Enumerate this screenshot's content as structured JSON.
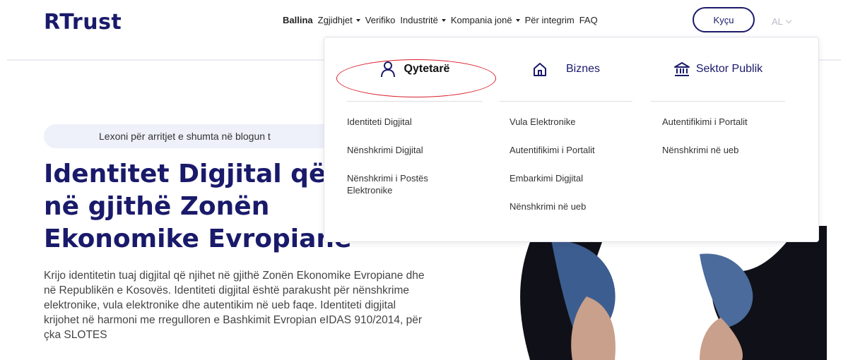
{
  "header": {
    "logo": "RTrust",
    "nav": [
      {
        "label": "Ballina",
        "active": true,
        "dropdown": false
      },
      {
        "label": "Zgjidhjet",
        "active": false,
        "dropdown": true
      },
      {
        "label": "Verifiko",
        "active": false,
        "dropdown": false
      },
      {
        "label": "Industritë",
        "active": false,
        "dropdown": true
      },
      {
        "label": "Kompania jonë",
        "active": false,
        "dropdown": true
      },
      {
        "label": "Për integrim",
        "active": false,
        "dropdown": false
      },
      {
        "label": "FAQ",
        "active": false,
        "dropdown": false
      }
    ],
    "login_label": "Kyçu",
    "language": "AL"
  },
  "hero": {
    "blog_banner": "Lexoni për arritjet e shumta në blogun t",
    "title_line1": "Identitet Digjital që",
    "title_line2": "në gjithë Zonën",
    "title_line3": "Ekonomike Evropiane",
    "description": "Krijo identitetin tuaj digjital që njihet në gjithë Zonën Ekonomike Evropiane dhe në Republikën e Kosovës. Identiteti digjital është parakusht për nënshkrime elektronike, vula elektronike dhe autentikim në ueb faqe. Identiteti digjital krijohet në harmoni me rregulloren e Bashkimit Evropian eIDAS 910/2014, për çka SLOTES"
  },
  "dropdown": {
    "columns": [
      {
        "title": "Qytetarë",
        "icon": "user-icon",
        "items": [
          "Identiteti Digjital",
          "Nënshkrimi Digjital",
          "Nënshkrimi i Postës Elektronike"
        ]
      },
      {
        "title": "Biznes",
        "icon": "home-icon",
        "items": [
          "Vula Elektronike",
          "Autentifikimi i Portalit",
          "Embarkimi Digjital",
          "Nënshkrimi në ueb"
        ]
      },
      {
        "title": "Sektor Publik",
        "icon": "bank-icon",
        "items": [
          "Autentifikimi i Portalit",
          "Nënshkrimi në ueb"
        ]
      }
    ]
  },
  "colors": {
    "brand": "#1a1a6b",
    "highlight": "#d81e2a",
    "banner_bg": "#eef0fa"
  }
}
